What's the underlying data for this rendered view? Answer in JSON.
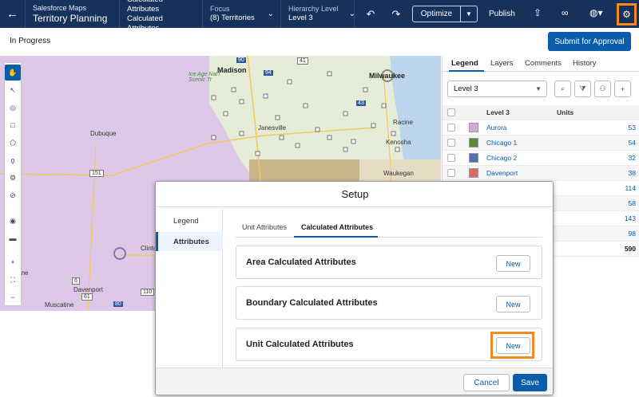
{
  "header": {
    "app_name": "Salesforce Maps",
    "page_title": "Territory Planning",
    "calc_line1": "Calculated Attributes",
    "calc_line2": "Calculated Attributes",
    "focus_label": "Focus",
    "focus_value": "(8) Territories",
    "hierarchy_label": "Hierarchy Level",
    "hierarchy_value": "Level 3",
    "optimize_label": "Optimize",
    "publish_label": "Publish"
  },
  "status": {
    "text": "In Progress",
    "submit_label": "Submit for Approval"
  },
  "map": {
    "labels": [
      "Madison",
      "Milwaukee",
      "Ice Age Nat'l Scenic Tr",
      "Janesville",
      "Racine",
      "Kenosha",
      "Waukegan",
      "Dubuque",
      "Davenport",
      "Muscatine",
      "Clinton",
      "Moline"
    ],
    "route_shields": [
      "90",
      "94",
      "43",
      "151",
      "41",
      "61",
      "6",
      "110",
      "80"
    ]
  },
  "panel": {
    "tabs": [
      "Legend",
      "Layers",
      "Comments",
      "History"
    ],
    "level_select": "Level 3",
    "columns": {
      "name": "Level 3",
      "units": "Units"
    },
    "rows": [
      {
        "name": "Aurora",
        "units": "53",
        "color": "#d9a6d9"
      },
      {
        "name": "Chicago 1",
        "units": "54",
        "color": "#5c8a3a"
      },
      {
        "name": "Chicago 2",
        "units": "32",
        "color": "#5470b0"
      },
      {
        "name": "Davenport",
        "units": "38",
        "color": "#d96b6b"
      },
      {
        "name": "",
        "units": "114",
        "color": ""
      },
      {
        "name": "",
        "units": "58",
        "color": ""
      },
      {
        "name": "",
        "units": "143",
        "color": ""
      },
      {
        "name": "",
        "units": "98",
        "color": ""
      }
    ],
    "total": "590"
  },
  "modal": {
    "title": "Setup",
    "side_items": [
      "Legend",
      "Attributes"
    ],
    "subtabs": [
      "Unit Attributes",
      "Calculated Attributes"
    ],
    "cards": [
      {
        "title": "Area Calculated Attributes",
        "button": "New"
      },
      {
        "title": "Boundary Calculated Attributes",
        "button": "New"
      },
      {
        "title": "Unit Calculated Attributes",
        "button": "New"
      }
    ],
    "cancel_label": "Cancel",
    "save_label": "Save"
  },
  "colors": {
    "header_bg": "#16325c",
    "brand_blue": "#0b5cab",
    "highlight": "#f28b1e"
  }
}
